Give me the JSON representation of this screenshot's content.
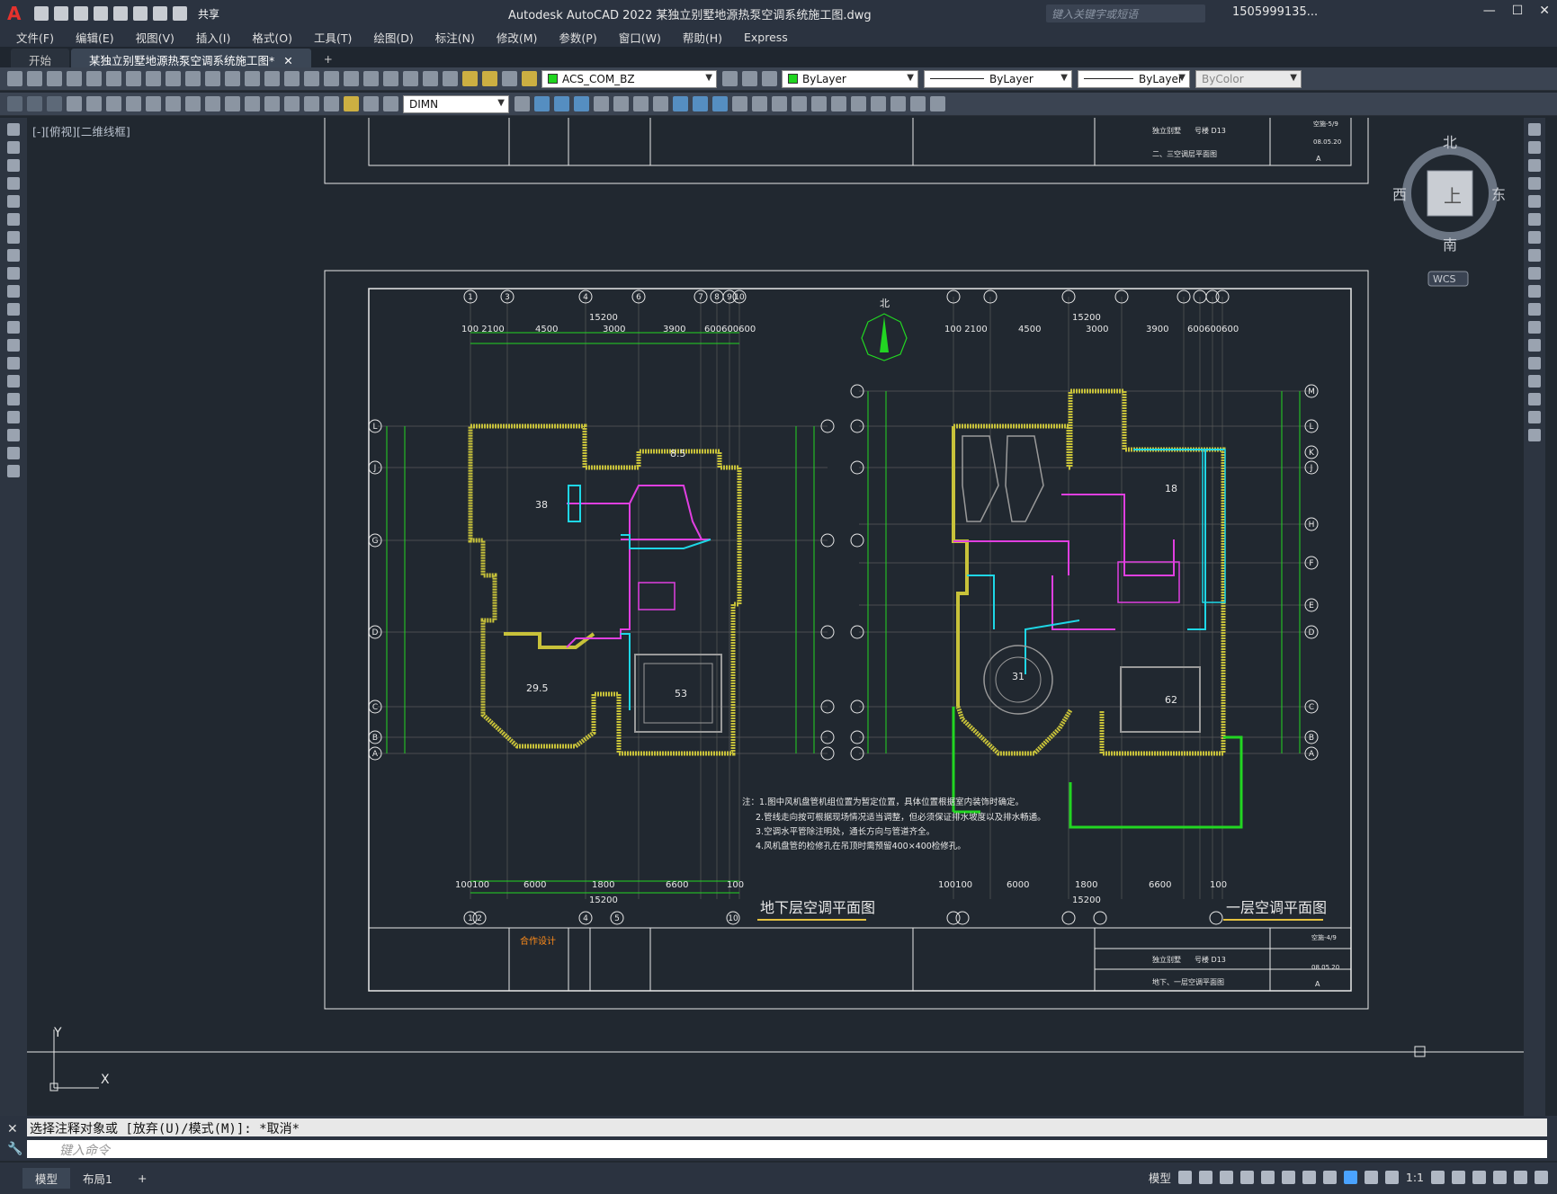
{
  "app": {
    "title": "Autodesk AutoCAD 2022    某独立别墅地源热泵空调系统施工图.dwg",
    "share_label": "共享",
    "search_placeholder": "键入关键字或短语",
    "user": "1505999135...",
    "brand_color": "#e5322d"
  },
  "menu": [
    "文件(F)",
    "编辑(E)",
    "视图(V)",
    "插入(I)",
    "格式(O)",
    "工具(T)",
    "绘图(D)",
    "标注(N)",
    "修改(M)",
    "参数(P)",
    "窗口(W)",
    "帮助(H)",
    "Express"
  ],
  "doc_tabs": [
    {
      "label": "开始"
    },
    {
      "label": "某独立别墅地源热泵空调系统施工图*"
    }
  ],
  "toolbar": {
    "layer": "ACS_COM_BZ",
    "color": "ByLayer",
    "linetype": "ByLayer",
    "lineweight": "ByLayer",
    "plotstyle": "ByColor",
    "dimstyle": "DIMN"
  },
  "view_label": "[-][俯视][二维线框]",
  "viewcube": {
    "n": "北",
    "s": "南",
    "e": "东",
    "w": "西",
    "top": "上",
    "wcs": "WCS"
  },
  "drawing": {
    "north_label": "北",
    "title_left": "地下层空调平面图",
    "title_right": "一层空调平面图",
    "notes": [
      "注：1.图中风机盘管机组位置为暂定位置，具体位置根据室内装饰时确定。",
      "2.管线走向按可根据现场情况适当调整，但必须保证排水坡度以及排水畅通。",
      "3.空调水平管除注明处，通长方向与管道齐全。",
      "4.风机盘管的检修孔在吊顶时需预留400×400检修孔。"
    ],
    "title_block_upper": {
      "project": "独立别墅",
      "number": "号楼 D13",
      "sheet": "二、三空调层平面图",
      "code": "空施-5/9",
      "date": "08.05.20",
      "version": "A"
    },
    "title_block_lower": {
      "project": "独立别墅",
      "number": "号楼 D13",
      "sheet": "地下、一层空调平面图",
      "code": "空施-4/9",
      "date": "08.05.20",
      "version": "A"
    },
    "coop": "合作设计",
    "dims_top_left": [
      "100 2100",
      "4500",
      "3000",
      "3900",
      "600600600"
    ],
    "dims_total": "15200",
    "dims_bottom_left": [
      "100100",
      "6000",
      "1800",
      "6600",
      "100"
    ],
    "rooms_left": [
      {
        "name": "38"
      },
      {
        "name": "8.5"
      },
      {
        "name": "53"
      },
      {
        "name": "29.5"
      }
    ],
    "rooms_right": [
      {
        "name": "18"
      },
      {
        "name": "31"
      },
      {
        "name": "62"
      }
    ],
    "axes_left": [
      "L",
      "J",
      "G",
      "D",
      "C",
      "B",
      "A"
    ],
    "axes_right": [
      "M",
      "L",
      "K",
      "J",
      "H",
      "F",
      "E",
      "D",
      "C",
      "B",
      "A"
    ],
    "axes_top": [
      "1",
      "3",
      "4",
      "6",
      "7",
      "8",
      "9",
      "10"
    ],
    "axes_bottom": [
      "1",
      "2",
      "4",
      "5",
      "10"
    ]
  },
  "command": {
    "history": "选择注释对象或 [放弃(U)/模式(M)]: *取消*",
    "placeholder": "键入命令"
  },
  "status": {
    "layout_tabs": [
      "模型",
      "布局1"
    ],
    "model_label": "模型",
    "scale": "1:1"
  }
}
